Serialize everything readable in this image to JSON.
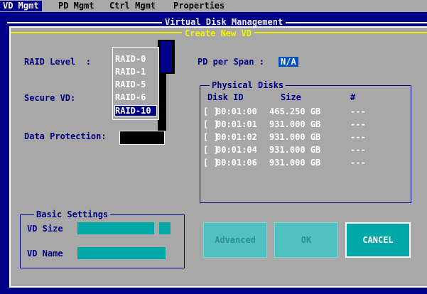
{
  "menubar": {
    "items": [
      "VD Mgmt",
      "PD Mgmt",
      "Ctrl Mgmt",
      "Properties"
    ]
  },
  "panel": {
    "title": "Virtual Disk Management"
  },
  "dialog": {
    "title": "Create New VD",
    "raid_level_label": "RAID Level  :",
    "secure_vd_label": "Secure VD:",
    "data_protection_label": "Data Protection:",
    "pd_per_span_label": "PD per Span :",
    "pd_per_span_value": "N/A",
    "raid_options": [
      "RAID-0",
      "RAID-1",
      "RAID-5",
      "RAID-6",
      "RAID-10"
    ],
    "raid_selected": "RAID-10"
  },
  "physical_disks": {
    "title": "Physical Disks",
    "headers": {
      "disk_id": "Disk ID",
      "size": "Size",
      "flag": "#"
    },
    "rows": [
      {
        "check": "[ ]",
        "id": "00:01:00",
        "size": "465.250 GB",
        "flag": "---"
      },
      {
        "check": "[ ]",
        "id": "00:01:01",
        "size": "931.000 GB",
        "flag": "---"
      },
      {
        "check": "[ ]",
        "id": "00:01:02",
        "size": "931.000 GB",
        "flag": "---"
      },
      {
        "check": "[ ]",
        "id": "00:01:04",
        "size": "931.000 GB",
        "flag": "---"
      },
      {
        "check": "[ ]",
        "id": "00:01:06",
        "size": "931.000 GB",
        "flag": "---"
      }
    ]
  },
  "basic_settings": {
    "title": "Basic Settings",
    "vd_size_label": "VD Size",
    "vd_name_label": "VD Name"
  },
  "buttons": {
    "advanced": "Advanced",
    "ok": "OK",
    "cancel": "CANCEL"
  },
  "colors": {
    "screen_bg": "#000088",
    "dialog_bg": "#a8a8a8",
    "accent_cyan": "#00a8a8",
    "title_yellow": "#f2f200"
  }
}
